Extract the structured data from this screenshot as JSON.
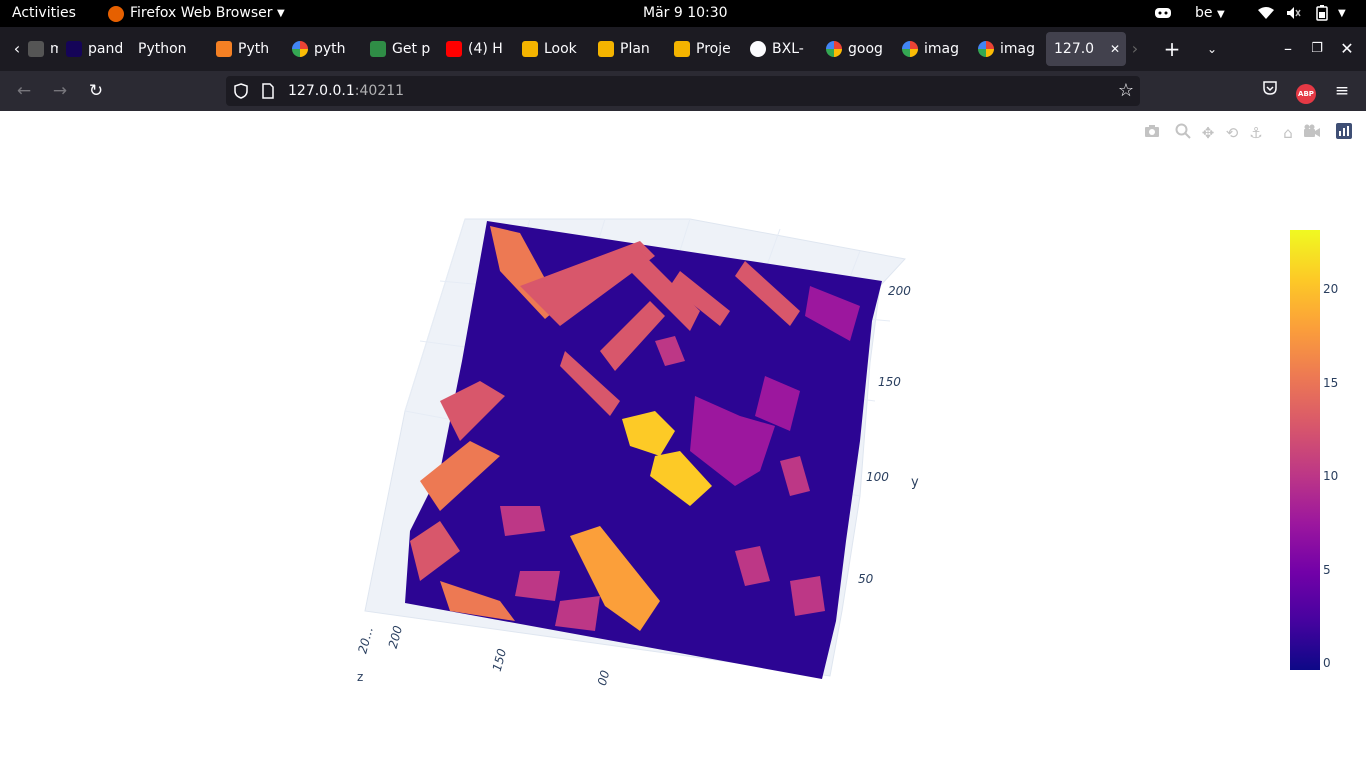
{
  "system_bar": {
    "activities": "Activities",
    "app_name": "Firefox Web Browser",
    "clock": "Mär 9  10:30",
    "keyboard_layout": "be"
  },
  "tabs": [
    {
      "label": "mg",
      "icon": "generic-icon"
    },
    {
      "label": "pand",
      "icon": "pandas-icon"
    },
    {
      "label": "Python",
      "icon": "none"
    },
    {
      "label": "Pyth",
      "icon": "stackoverflow-icon"
    },
    {
      "label": "pyth",
      "icon": "google-icon"
    },
    {
      "label": "Get p",
      "icon": "geeksforgeeks-icon"
    },
    {
      "label": "(4) H",
      "icon": "youtube-icon"
    },
    {
      "label": "Look",
      "icon": "slides-icon"
    },
    {
      "label": "Plan",
      "icon": "slides-icon"
    },
    {
      "label": "Proje",
      "icon": "slides-icon"
    },
    {
      "label": "BXL-",
      "icon": "github-icon"
    },
    {
      "label": "goog",
      "icon": "google-icon"
    },
    {
      "label": "imag",
      "icon": "google-icon"
    },
    {
      "label": "imag",
      "icon": "google-icon"
    },
    {
      "label": "127.0",
      "icon": "none",
      "active": true
    }
  ],
  "url": {
    "host": "127.0.0.1",
    "port": ":40211"
  },
  "extensions": {
    "abp_badge": "ABP"
  },
  "plot": {
    "y_axis_title": "y",
    "y_ticks": [
      "200",
      "150",
      "100",
      "50"
    ],
    "x_ticks": [
      "200",
      "150",
      "00"
    ],
    "x_ticks_overlapping": "20…",
    "z_stub": "z",
    "colorbar_ticks": [
      "20",
      "15",
      "10",
      "5",
      "0"
    ],
    "colorscale": [
      "#0d0887",
      "#46039f",
      "#7201a8",
      "#9c179e",
      "#bd3786",
      "#d8576b",
      "#ed7953",
      "#fb9f3a",
      "#fdca26",
      "#f0f921"
    ],
    "colorscale_name": "Plasma",
    "modebar_icons": [
      "camera-icon",
      "zoom-icon",
      "pan-icon",
      "orbit-icon",
      "turntable-icon",
      "home-icon",
      "camera-views-icon",
      "plotly-logo-icon"
    ]
  }
}
